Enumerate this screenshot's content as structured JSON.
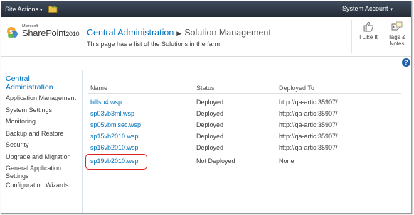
{
  "topbar": {
    "site_actions": "Site Actions",
    "account": "System Account"
  },
  "logo": {
    "microsoft": "Microsoft",
    "product": "SharePoint",
    "year": "2010"
  },
  "header": {
    "breadcrumb_root": "Central Administration",
    "breadcrumb_current": "Solution Management",
    "subtitle": "This page has a list of the Solutions in the farm."
  },
  "social": {
    "like": "I Like It",
    "tags_line1": "Tags &",
    "tags_line2": "Notes"
  },
  "help": "?",
  "nav": {
    "heading_line1": "Central",
    "heading_line2": "Administration",
    "items": [
      "Application Management",
      "System Settings",
      "Monitoring",
      "Backup and Restore",
      "Security",
      "Upgrade and Migration",
      "General Application Settings",
      "Configuration Wizards"
    ]
  },
  "table": {
    "headers": {
      "name": "Name",
      "status": "Status",
      "deployed_to": "Deployed To"
    },
    "rows": [
      {
        "name": "billsp4.wsp",
        "status": "Deployed",
        "deployed_to": "http://qa-artic:35907/"
      },
      {
        "name": "sp03vb3ml.wsp",
        "status": "Deployed",
        "deployed_to": "http://qa-artic:35907/"
      },
      {
        "name": "sp05vbmlsec.wsp",
        "status": "Deployed",
        "deployed_to": "http://qa-artic:35907/"
      },
      {
        "name": "sp15vb2010.wsp",
        "status": "Deployed",
        "deployed_to": "http://qa-artic:35907/"
      },
      {
        "name": "sp16vb2010.wsp",
        "status": "Deployed",
        "deployed_to": "http://qa-artic:35907/"
      },
      {
        "name": "sp19vb2010.wsp",
        "status": "Not Deployed",
        "deployed_to": "None"
      }
    ]
  },
  "icons": {
    "folder": "folder-icon",
    "like": "like-icon",
    "tags": "tags-icon",
    "help": "help-icon",
    "logo": "sharepoint-logo-icon"
  },
  "colors": {
    "link": "#0072bc",
    "topbar": "#2b3441",
    "highlight": "#e02020"
  }
}
